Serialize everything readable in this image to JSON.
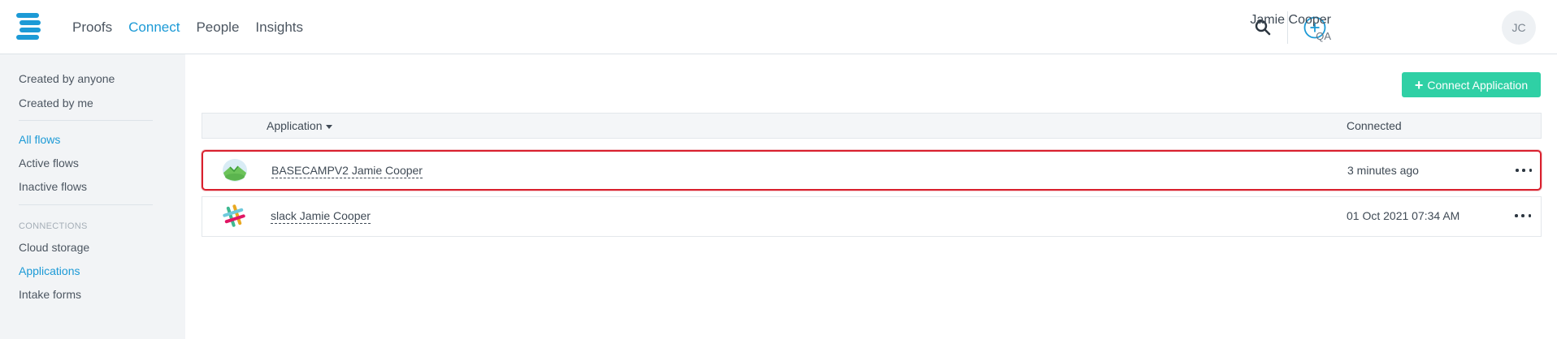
{
  "nav": {
    "items": [
      {
        "label": "Proofs",
        "active": false
      },
      {
        "label": "Connect",
        "active": true
      },
      {
        "label": "People",
        "active": false
      },
      {
        "label": "Insights",
        "active": false
      }
    ]
  },
  "user": {
    "name": "Jamie Cooper",
    "role": "QA",
    "initials": "JC"
  },
  "sidebar": {
    "created_anyone": "Created by anyone",
    "created_me": "Created by me",
    "all_flows": "All flows",
    "active_flows": "Active flows",
    "inactive_flows": "Inactive flows",
    "connections_heading": "Connections",
    "cloud_storage": "Cloud storage",
    "applications": "Applications",
    "intake_forms": "Intake forms"
  },
  "toolbar": {
    "connect_label": "Connect Application"
  },
  "table": {
    "columns": {
      "application": "Application",
      "connected": "Connected"
    },
    "rows": [
      {
        "app": "BASECAMPV2 Jamie Cooper",
        "connected": "3 minutes ago",
        "icon": "basecamp-icon",
        "highlighted": true
      },
      {
        "app": "slack Jamie Cooper",
        "connected": "01 Oct 2021 07:34 AM",
        "icon": "slack-icon",
        "highlighted": false
      }
    ]
  },
  "colors": {
    "accent": "#1c9ad6",
    "button": "#2fd0a5",
    "highlight": "#d9202e"
  }
}
